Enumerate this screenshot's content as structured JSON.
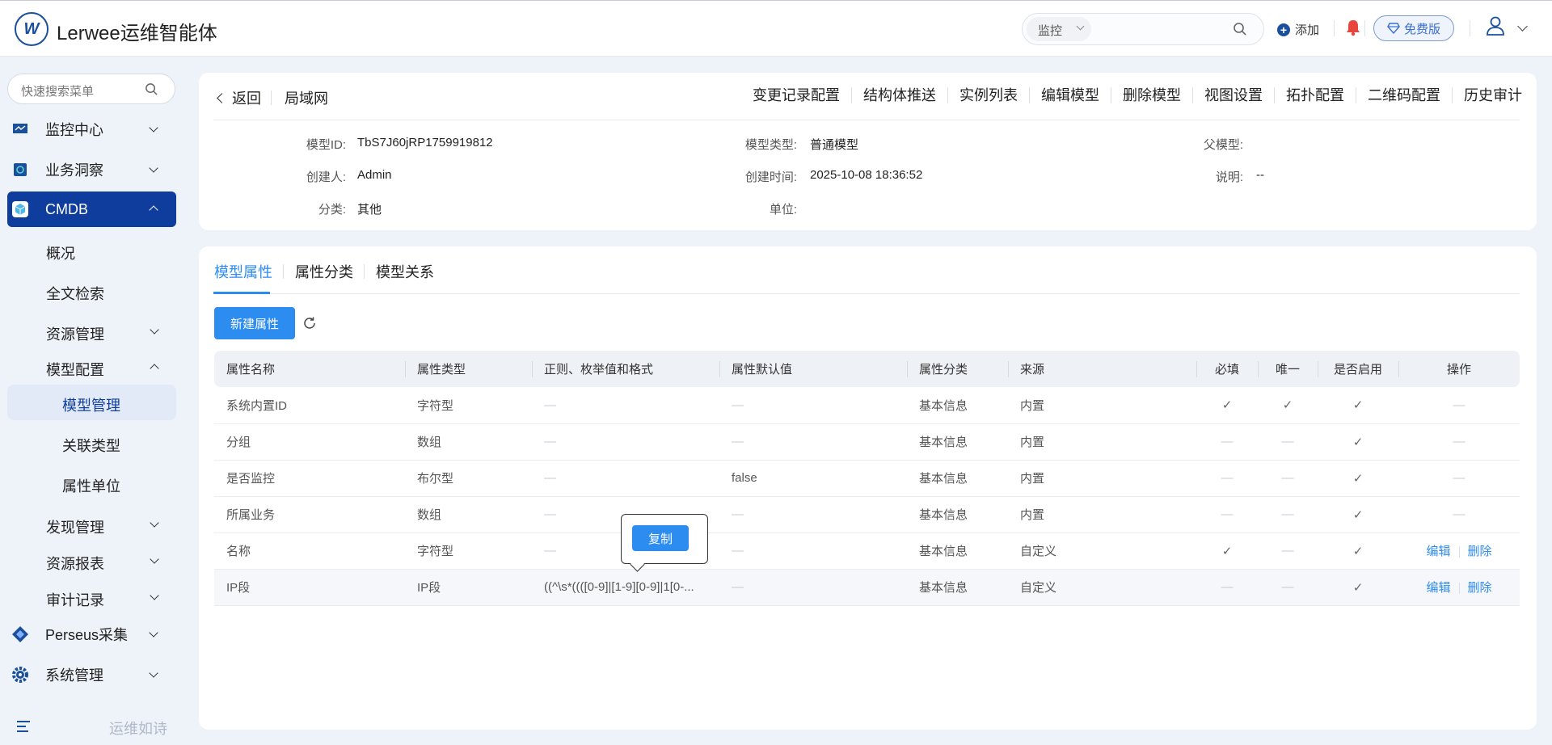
{
  "app": {
    "title": "Lerwee运维智能体",
    "logo_letter": "W"
  },
  "header": {
    "search_scope": "监控",
    "add_label": "添加",
    "free_label": "免费版"
  },
  "sidebar": {
    "search_placeholder": "快速搜索菜单",
    "items": [
      {
        "label": "监控中心"
      },
      {
        "label": "业务洞察"
      },
      {
        "label": "CMDB"
      },
      {
        "label": "Perseus采集"
      },
      {
        "label": "系统管理"
      }
    ],
    "cmdb_children": [
      "概况",
      "全文检索",
      "资源管理",
      "模型配置",
      "发现管理",
      "资源报表",
      "审计记录"
    ],
    "model_config_children": [
      "模型管理",
      "关联类型",
      "属性单位"
    ],
    "footer_text": "运维如诗"
  },
  "detail": {
    "back_label": "返回",
    "crumb": "局域网",
    "actions": [
      "变更记录配置",
      "结构体推送",
      "实例列表",
      "编辑模型",
      "删除模型",
      "视图设置",
      "拓扑配置",
      "二维码配置",
      "历史审计"
    ],
    "fields": {
      "model_id_label": "模型ID:",
      "model_id": "TbS7J60jRP1759919812",
      "model_type_label": "模型类型:",
      "model_type": "普通模型",
      "parent_label": "父模型:",
      "parent": "",
      "creator_label": "创建人:",
      "creator": "Admin",
      "created_label": "创建时间:",
      "created": "2025-10-08 18:36:52",
      "desc_label": "说明:",
      "desc": "--",
      "category_label": "分类:",
      "category": "其他",
      "unit_label": "单位:",
      "unit": ""
    }
  },
  "tabs": [
    "模型属性",
    "属性分类",
    "模型关系"
  ],
  "toolbar": {
    "new_label": "新建属性"
  },
  "table": {
    "headers": [
      "属性名称",
      "属性类型",
      "正则、枚举值和格式",
      "属性默认值",
      "属性分类",
      "来源",
      "必填",
      "唯一",
      "是否启用",
      "操作"
    ],
    "rows": [
      {
        "name": "系统内置ID",
        "type": "字符型",
        "regex": "—",
        "default": "—",
        "category": "基本信息",
        "source": "内置",
        "required": "✓",
        "unique": "✓",
        "enabled": "✓",
        "op": "—"
      },
      {
        "name": "分组",
        "type": "数组",
        "regex": "—",
        "default": "—",
        "category": "基本信息",
        "source": "内置",
        "required": "—",
        "unique": "—",
        "enabled": "✓",
        "op": "—"
      },
      {
        "name": "是否监控",
        "type": "布尔型",
        "regex": "—",
        "default": "false",
        "category": "基本信息",
        "source": "内置",
        "required": "—",
        "unique": "—",
        "enabled": "✓",
        "op": "—"
      },
      {
        "name": "所属业务",
        "type": "数组",
        "regex": "—",
        "default": "—",
        "category": "基本信息",
        "source": "内置",
        "required": "—",
        "unique": "—",
        "enabled": "✓",
        "op": "—"
      },
      {
        "name": "名称",
        "type": "字符型",
        "regex": "—",
        "default": "—",
        "category": "基本信息",
        "source": "自定义",
        "required": "✓",
        "unique": "—",
        "enabled": "✓",
        "edit": "编辑",
        "delete": "删除"
      },
      {
        "name": "IP段",
        "type": "IP段",
        "regex": "((^\\s*((([0-9]|[1-9][0-9]|1[0-...",
        "default": "—",
        "category": "基本信息",
        "source": "自定义",
        "required": "—",
        "unique": "—",
        "enabled": "✓",
        "edit": "编辑",
        "delete": "删除"
      }
    ]
  },
  "tooltip": {
    "copy_label": "复制"
  },
  "colors": {
    "primary": "#2d8cf0",
    "brand": "#0e3d9e",
    "bell": "#e8453c"
  }
}
